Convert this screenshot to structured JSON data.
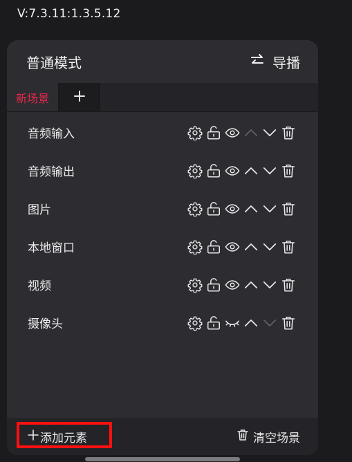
{
  "version": "V:7.3.11:1.3.5.12",
  "header": {
    "mode_title": "普通模式",
    "switch_label": "导播",
    "switch_icon": "swap-arrows-icon"
  },
  "tabs": {
    "active_scene": "新场景",
    "add_icon": "plus-icon"
  },
  "elements": [
    {
      "label": "音频输入",
      "visible": true,
      "up_enabled": false,
      "down_enabled": true
    },
    {
      "label": "音频输出",
      "visible": true,
      "up_enabled": true,
      "down_enabled": true
    },
    {
      "label": "图片",
      "visible": true,
      "up_enabled": true,
      "down_enabled": true
    },
    {
      "label": "本地窗口",
      "visible": true,
      "up_enabled": true,
      "down_enabled": true
    },
    {
      "label": "视频",
      "visible": true,
      "up_enabled": true,
      "down_enabled": true
    },
    {
      "label": "摄像头",
      "visible": false,
      "up_enabled": true,
      "down_enabled": false
    }
  ],
  "footer": {
    "add_element": "添加元素",
    "clear_scene": "清空场景"
  },
  "colors": {
    "accent": "#e8284a",
    "highlight": "#ff1010",
    "panel": "#2c2c31"
  }
}
